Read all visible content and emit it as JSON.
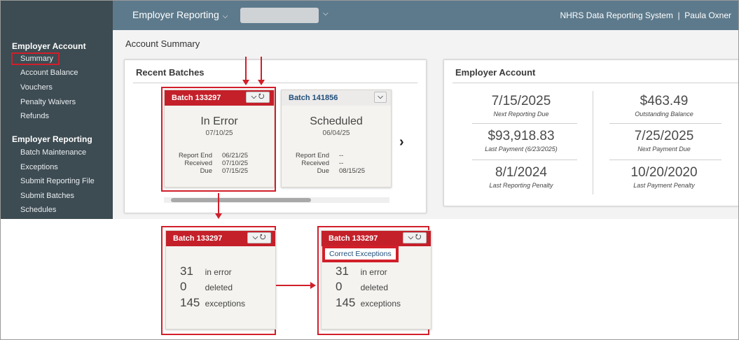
{
  "header": {
    "module": "Employer Reporting",
    "module_chevron": "❯",
    "system_name": "NHRS Data Reporting System",
    "separator": "|",
    "user_name": "Paula Oxner"
  },
  "sidebar": {
    "section1": "Employer Account",
    "items1": [
      "Summary",
      "Account Balance",
      "Vouchers",
      "Penalty Waivers",
      "Refunds"
    ],
    "section2": "Employer Reporting",
    "items2": [
      "Batch Maintenance",
      "Exceptions",
      "Submit Reporting File",
      "Submit Batches",
      "Schedules"
    ]
  },
  "page": {
    "title": "Account Summary"
  },
  "recent_batches": {
    "title": "Recent Batches",
    "cards": [
      {
        "batch": "Batch 133297",
        "status": "In Error",
        "date": "07/10/25",
        "rows": [
          {
            "k": "Report End",
            "v": "06/21/25"
          },
          {
            "k": "Received",
            "v": "07/10/25"
          },
          {
            "k": "Due",
            "v": "07/15/25"
          }
        ]
      },
      {
        "batch": "Batch 141856",
        "status": "Scheduled",
        "date": "06/04/25",
        "rows": [
          {
            "k": "Report End",
            "v": "--"
          },
          {
            "k": "Received",
            "v": "--"
          },
          {
            "k": "Due",
            "v": "08/15/25"
          }
        ]
      }
    ],
    "next_icon": "›"
  },
  "employer_account": {
    "title": "Employer Account",
    "stats": [
      {
        "value": "7/15/2025",
        "label": "Next Reporting Due"
      },
      {
        "value": "$463.49",
        "label": "Outstanding Balance"
      },
      {
        "value": "$93,918.83",
        "label": "Last Payment (6/23/2025)"
      },
      {
        "value": "7/25/2025",
        "label": "Next Payment Due"
      },
      {
        "value": "8/1/2024",
        "label": "Last Reporting Penalty"
      },
      {
        "value": "10/20/2020",
        "label": "Last Payment Penalty"
      }
    ]
  },
  "flipped_cards": {
    "batch": "Batch 133297",
    "lines": [
      {
        "n": "31",
        "l": "in error"
      },
      {
        "n": "0",
        "l": "deleted"
      },
      {
        "n": "145",
        "l": "exceptions"
      }
    ],
    "menu_item": "Correct Exceptions"
  },
  "colors": {
    "header": "#5d7a8c",
    "sidebar": "#3d4b52",
    "accent_red": "#c4202a",
    "highlight": "#d11f2a"
  },
  "icons": [
    "chevron-down-icon",
    "refresh-icon",
    "chevron-right-icon"
  ]
}
